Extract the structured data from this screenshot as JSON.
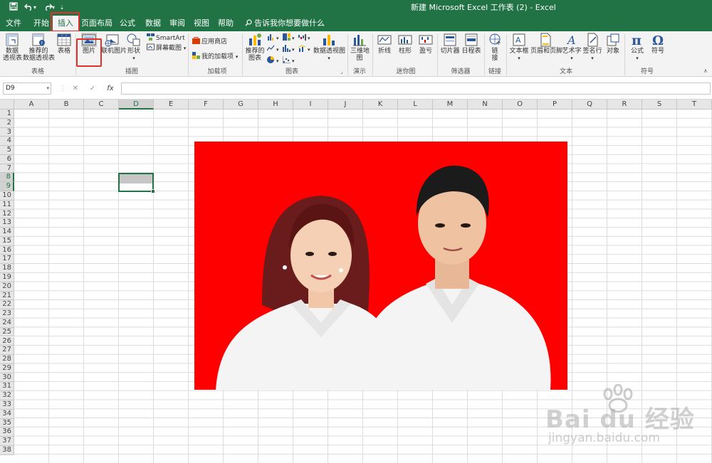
{
  "window": {
    "title": "新建 Microsoft Excel 工作表 (2)  -  Excel",
    "accent_color": "#217346",
    "quick_access": [
      {
        "name": "save-icon",
        "glyph": "🖫"
      },
      {
        "name": "undo-icon",
        "glyph": "↶"
      },
      {
        "name": "undo-dropdown-icon",
        "glyph": "▾"
      },
      {
        "name": "redo-icon",
        "glyph": "↷"
      },
      {
        "name": "redo-dropdown-icon",
        "glyph": "▾"
      },
      {
        "name": "customize-qat-icon",
        "glyph": "⇣"
      }
    ]
  },
  "tabs": [
    {
      "label": "文件"
    },
    {
      "label": "开始"
    },
    {
      "label": "插入",
      "active": true
    },
    {
      "label": "页面布局"
    },
    {
      "label": "公式"
    },
    {
      "label": "数据"
    },
    {
      "label": "审阅"
    },
    {
      "label": "视图"
    },
    {
      "label": "帮助"
    }
  ],
  "tell_me": "告诉我你想要做什么",
  "ribbon": {
    "tables": {
      "group_label": "表格",
      "pivot_table": "数据\n透视表",
      "recommended_pivot": "推荐的\n数据透视表",
      "table": "表格"
    },
    "illustrations": {
      "group_label": "插图",
      "pictures": "图片",
      "online_pictures": "联机图片",
      "shapes": "形状",
      "smartart": "SmartArt",
      "screenshot": "屏幕截图"
    },
    "addins": {
      "group_label": "加载项",
      "store": "应用商店",
      "my_addins": "我的加载项"
    },
    "charts": {
      "group_label": "图表",
      "recommended_charts": "推荐的\n图表",
      "pivot_chart": "数据透视图"
    },
    "tours": {
      "group_label": "演示",
      "map3d": "三维地\n图"
    },
    "sparklines": {
      "group_label": "迷你图",
      "line": "折线",
      "column": "柱形",
      "winloss": "盈亏"
    },
    "filters": {
      "group_label": "筛选器",
      "slicer": "切片器",
      "timeline": "日程表"
    },
    "links": {
      "group_label": "链接",
      "link": "链\n接"
    },
    "text": {
      "group_label": "文本",
      "textbox": "文本框",
      "header_footer": "页眉和页脚",
      "wordart": "艺术字",
      "signature": "签名行",
      "object": "对象"
    },
    "symbols": {
      "group_label": "符号",
      "equation": "公式",
      "symbol": "符号"
    }
  },
  "formula_bar": {
    "name_box": "D9",
    "cancel": "✕",
    "enter": "✓",
    "fx": "fx",
    "value": ""
  },
  "grid": {
    "columns": [
      "A",
      "B",
      "C",
      "D",
      "E",
      "F",
      "G",
      "H",
      "I",
      "J",
      "K",
      "L",
      "M",
      "N",
      "O",
      "P",
      "Q",
      "R",
      "S",
      "T"
    ],
    "rows": [
      "1",
      "2",
      "3",
      "4",
      "5",
      "6",
      "7",
      "8",
      "9",
      "10",
      "11",
      "12",
      "13",
      "14",
      "15",
      "16",
      "17",
      "18",
      "19",
      "20",
      "21",
      "22",
      "23",
      "24",
      "25",
      "26",
      "27",
      "28",
      "29",
      "30",
      "31",
      "32",
      "33",
      "34",
      "35",
      "36",
      "37",
      "38"
    ],
    "selected_column": "D",
    "selected_rows": [
      "8",
      "9"
    ]
  },
  "picture": {
    "background_color": "#ff0000",
    "subjects": [
      "woman-in-white-shirt",
      "man-in-white-shirt"
    ]
  },
  "watermark": {
    "brand": "Bai  du 经验",
    "url": "jingyan.baidu.com"
  }
}
